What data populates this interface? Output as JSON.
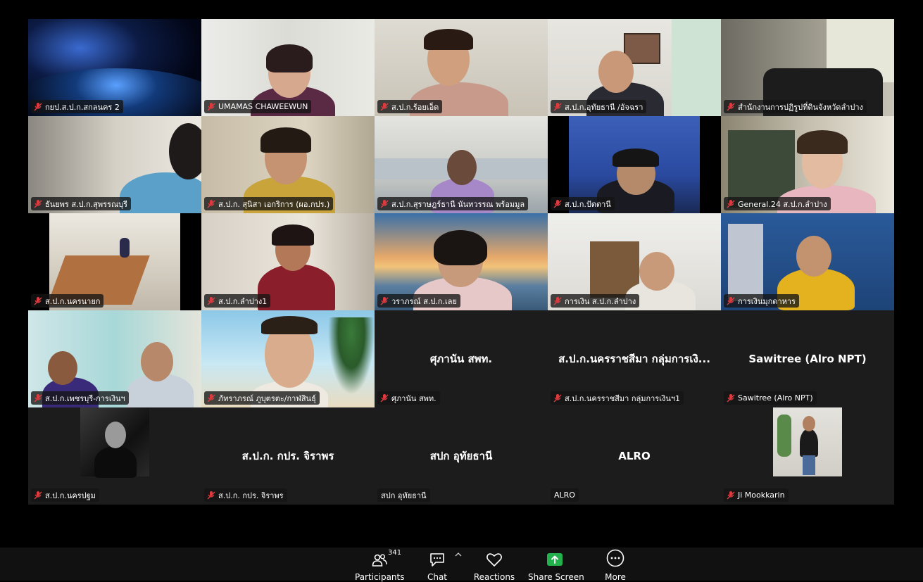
{
  "participants_grid": {
    "tiles": [
      {
        "name": "กยป.ส.ป.ก.สกลนคร 2"
      },
      {
        "name": "UMAMAS CHAWEEWUN"
      },
      {
        "name": "ส.ป.ก.ร้อยเอ็ด"
      },
      {
        "name": "ส.ป.ก.อุทัยธานี /อัจฉรา"
      },
      {
        "name": "สำนักงานการปฏิรูปที่ดินจังหวัดลำปาง"
      },
      {
        "name": "ธันยพร ส.ป.ก.สุพรรณบุรี"
      },
      {
        "name": "ส.ป.ก. สุนิสา เอกริการ (ผอ.กปร.)"
      },
      {
        "name": "ส.ป.ก.สุราษฎร์ธานี นันทวรรณ พร้อมมูล"
      },
      {
        "name": "ส.ป.ก.ปัตตานี"
      },
      {
        "name": "General.24 ส.ป.ก.ลำปาง"
      },
      {
        "name": "ส.ป.ก.นครนายก"
      },
      {
        "name": "ส.ป.ก.ลำปาง1"
      },
      {
        "name": "วราภรณ์ ส.ป.ก.เลย"
      },
      {
        "name": "การเงิน ส.ป.ก.ลำปาง"
      },
      {
        "name": "การเงินมุกดาหาร"
      },
      {
        "name": "ส.ป.ก.เพชรบุรี-การเงินฯ"
      },
      {
        "name": "ภัทราภรณ์ ภูบุตรตะ/กาฬสินธุ์"
      },
      {
        "name": "ศุภานัน สพท.",
        "display_name": "ศุภานัน สพท."
      },
      {
        "name": "ส.ป.ก.นครราชสีมา กลุ่มการเงินฯ1",
        "display_name": "ส.ป.ก.นครราชสีมา กลุ่มการเงิ..."
      },
      {
        "name": "Sawitree (Alro NPT)",
        "display_name": "Sawitree (Alro NPT)"
      },
      {
        "name": "ส.ป.ก.นครปฐม"
      },
      {
        "name": "ส.ป.ก. กปร. จิราพร",
        "display_name": "ส.ป.ก. กปร. จิราพร"
      },
      {
        "name": "สปก อุทัยธานี",
        "display_name": "สปก อุทัยธานี"
      },
      {
        "name": "ALRO",
        "display_name": "ALRO"
      },
      {
        "name": "Ji Mookkarin"
      }
    ]
  },
  "toolbar": {
    "participants": {
      "label": "Participants",
      "count": "341",
      "icon": "participants-icon"
    },
    "chat": {
      "label": "Chat",
      "icon": "chat-icon"
    },
    "reactions": {
      "label": "Reactions",
      "icon": "heart-icon"
    },
    "share_screen": {
      "label": "Share Screen",
      "icon": "share-screen-icon"
    },
    "more": {
      "label": "More",
      "icon": "more-icon"
    }
  },
  "colors": {
    "muted_mic": "#e0393e",
    "share_green": "#22b14c",
    "toolbar_bg": "#111111"
  }
}
